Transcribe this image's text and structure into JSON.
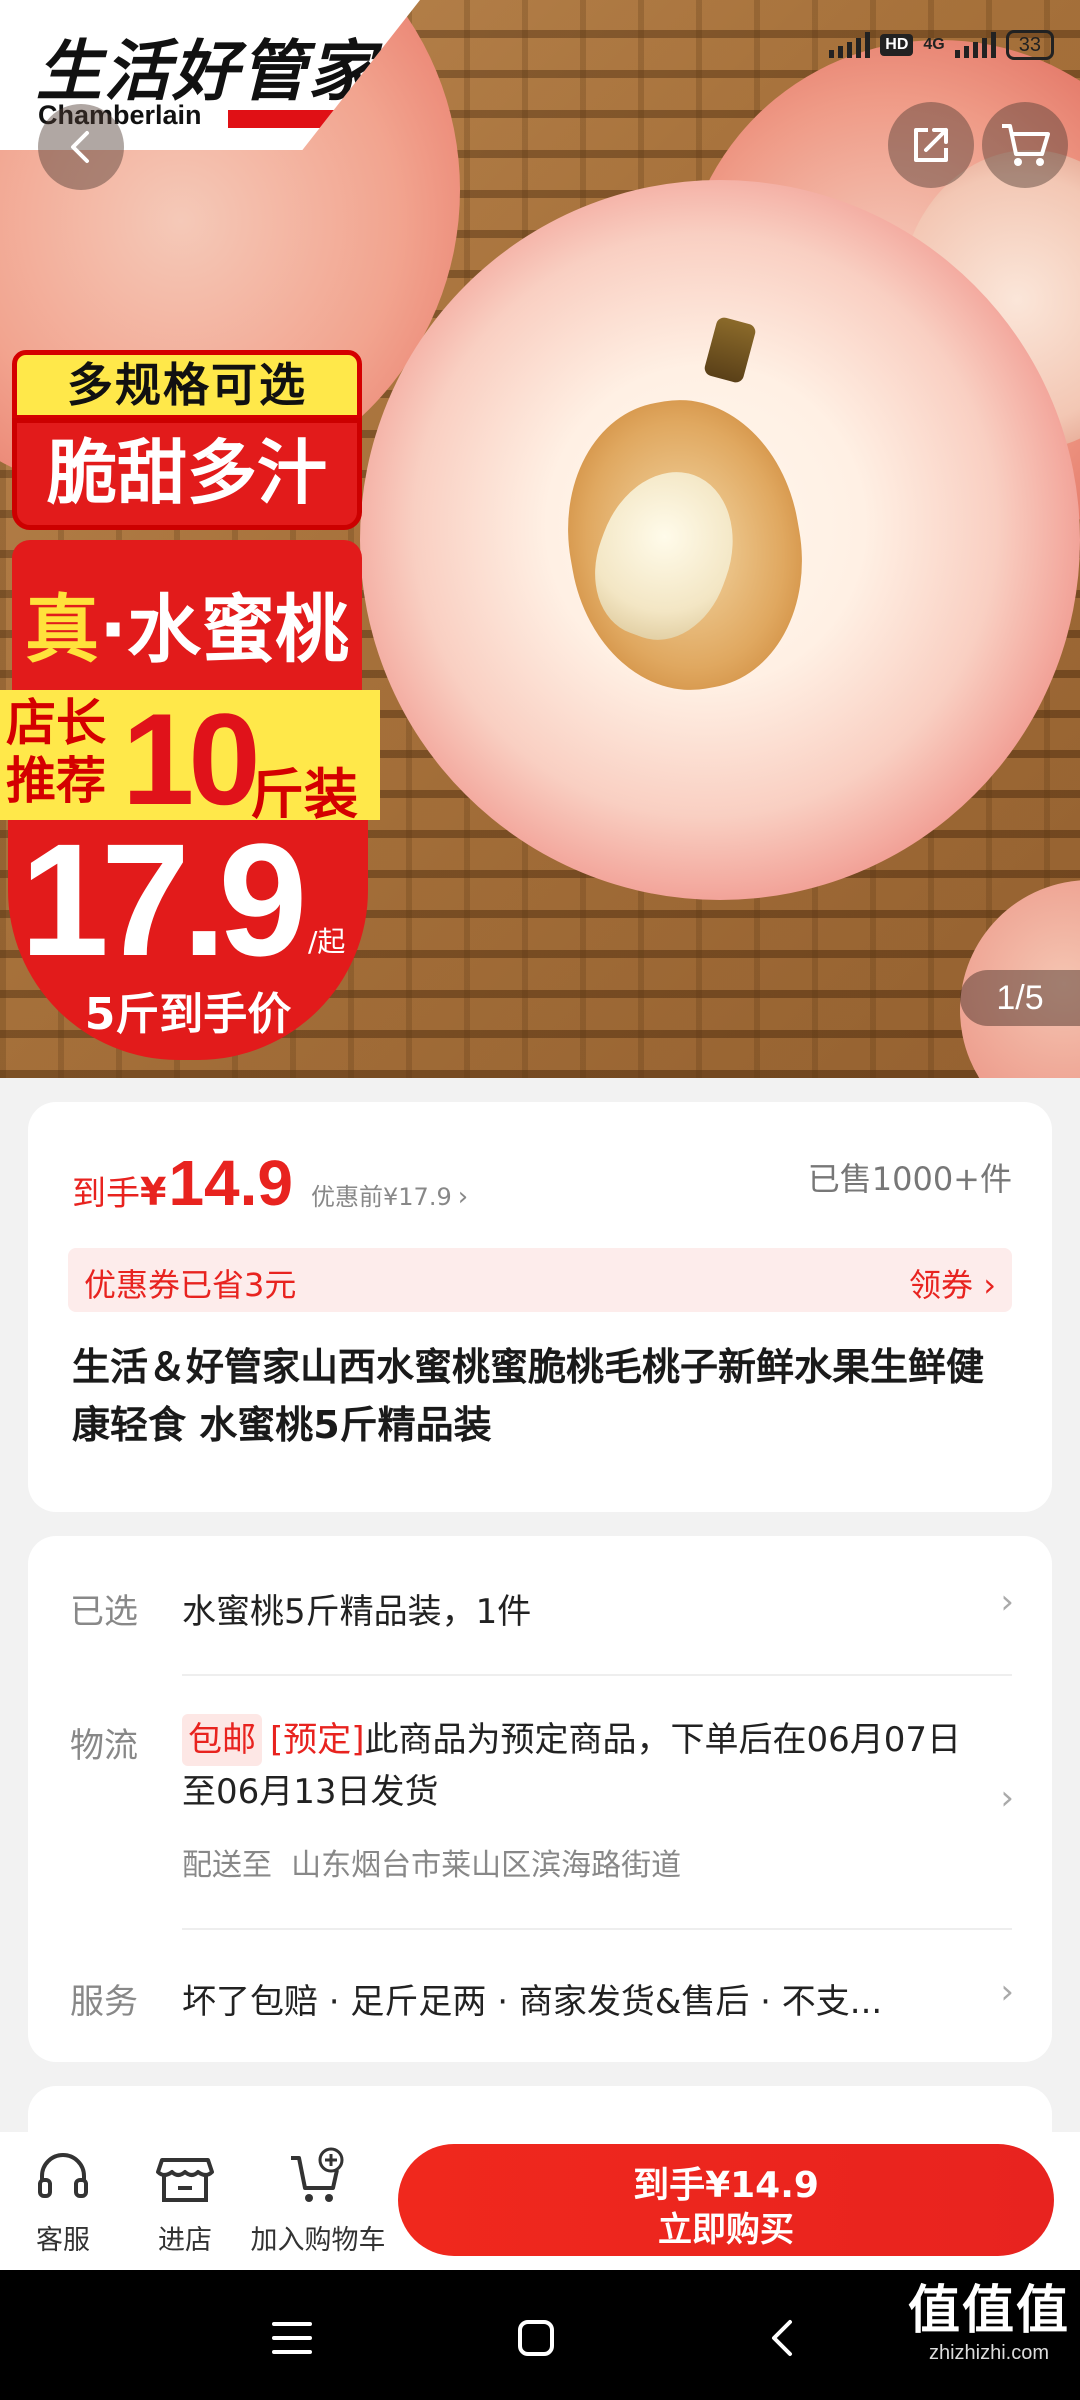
{
  "status_bar": {
    "network": "4G",
    "hd": "HD",
    "battery": "33"
  },
  "logo": {
    "cn": "生活好管家",
    "en": "Chamberlain"
  },
  "promo": {
    "line1": "多规格可选",
    "line2": "脆甜多汁",
    "line3_zhen": "真",
    "line3_rest": "·水蜜桃",
    "line4_left": "店长推荐",
    "line4_num": "10",
    "line4_unit": "斤装",
    "price": "17.9",
    "price_suffix": "/起",
    "price_sub": "5斤到手价"
  },
  "gallery": {
    "pager": "1/5"
  },
  "price_card": {
    "prefix": "到手",
    "yen": "¥",
    "amount": "14.9",
    "before": "优惠前¥17.9",
    "sold": "已售1000+件",
    "coupon_text": "优惠券已省3元",
    "coupon_action": "领券 ›",
    "title": "生活＆好管家山西水蜜桃蜜脆桃毛桃子新鲜水果生鲜健康轻食 水蜜桃5斤精品装"
  },
  "detail_card": {
    "selected_label": "已选",
    "selected_value": "水蜜桃5斤精品装，1件",
    "logistics_label": "物流",
    "free_shipping": "包邮",
    "preorder_tag": "[预定]",
    "logistics_text": "此商品为预定商品，下单后在06月07日至06月13日发货",
    "ship_to_label": "配送至",
    "ship_to_address": "山东烟台市莱山区滨海路街道",
    "service_label": "服务",
    "service_value": "坏了包赔 · 足斤足两 · 商家发货&售后 · 不支..."
  },
  "action_bar": {
    "service": "客服",
    "store": "进店",
    "add_cart": "加入购物车",
    "buy_line1": "到手¥14.9",
    "buy_line2": "立即购买"
  },
  "watermark": {
    "big": "值值值",
    "small": "zhizhizhi.com"
  },
  "colors": {
    "accent": "#e8231f",
    "coupon_bg": "#fdeceb"
  }
}
